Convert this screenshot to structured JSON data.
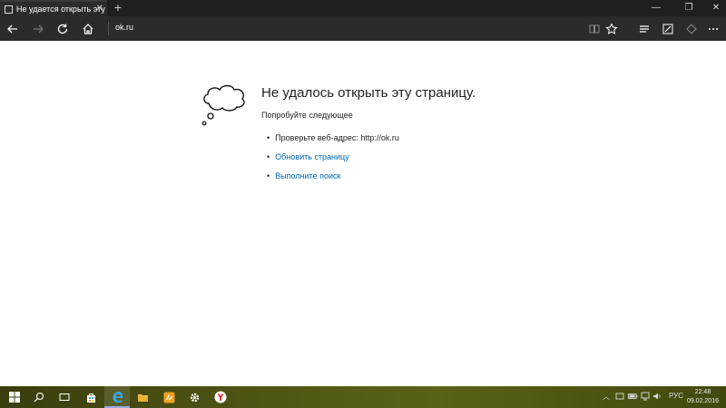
{
  "tab": {
    "title": "Не удается открыть эту"
  },
  "addressbar": {
    "url": "ok.ru"
  },
  "error": {
    "title": "Не удалось открыть эту страницу.",
    "subtitle": "Попробуйте следующее",
    "check_address": "Проверьте веб-адрес: http://ok.ru",
    "refresh_link": "Обновить страницу",
    "search_link": "Выполните поиск"
  },
  "taskbar": {
    "language": "РУС",
    "time": "22:48",
    "date": "09.02.2016"
  },
  "colors": {
    "link": "#0067b8",
    "browser_chrome": "#2b2b2b",
    "taskbar": "#4c5214"
  },
  "icons": [
    "back-icon",
    "forward-icon",
    "refresh-icon",
    "home-icon",
    "reading-view-icon",
    "favorite-star-icon",
    "hub-icon",
    "web-note-icon",
    "share-icon",
    "windows-start-icon",
    "search-icon",
    "task-view-icon",
    "store-icon",
    "edge-icon",
    "file-explorer-icon",
    "app-icon",
    "settings-icon",
    "yandex-icon"
  ]
}
